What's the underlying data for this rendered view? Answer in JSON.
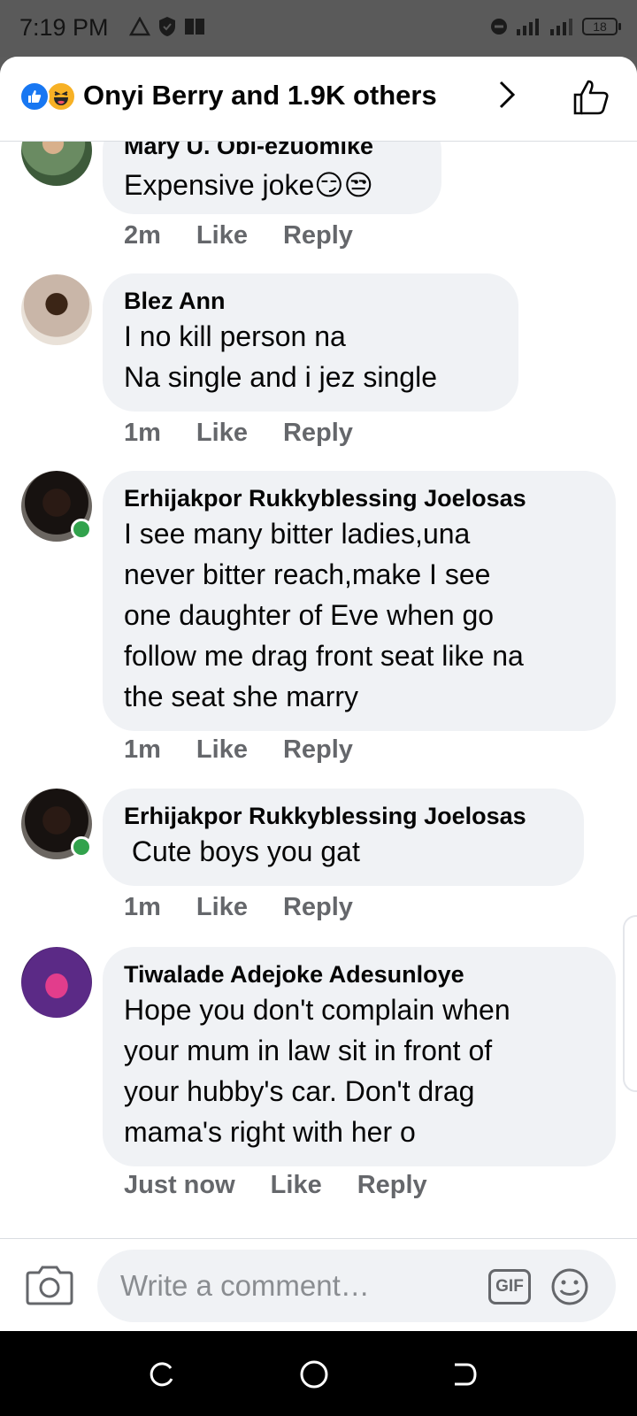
{
  "status_bar": {
    "time": "7:19 PM",
    "battery": "18"
  },
  "header": {
    "reactions_text": "Onyi Berry and 1.9K others"
  },
  "comments": [
    {
      "author": "Mary U. Obi-ezuomike",
      "text": "Expensive joke😏😒",
      "time": "2m",
      "like": "Like",
      "reply": "Reply",
      "online": false
    },
    {
      "author": "Blez Ann",
      "lines": [
        "I no kill person na",
        "Na single and i jez  single"
      ],
      "time": "1m",
      "like": "Like",
      "reply": "Reply",
      "online": false
    },
    {
      "author": "Erhijakpor Rukkyblessing Joelosas",
      "lines": [
        "I see many bitter ladies,una",
        "never bitter reach,make I see",
        "one daughter of Eve when go",
        "follow me drag front seat like na",
        "the seat she marry"
      ],
      "time": "1m",
      "like": "Like",
      "reply": "Reply",
      "online": true
    },
    {
      "author": "Erhijakpor Rukkyblessing Joelosas",
      "text": " Cute boys you gat",
      "time": "1m",
      "like": "Like",
      "reply": "Reply",
      "online": true
    },
    {
      "author": "Tiwalade Adejoke Adesunloye",
      "lines": [
        "Hope you don't complain when",
        "your mum in law sit in front of",
        "your hubby's car. Don't drag",
        "mama's right with her o"
      ],
      "time": "Just now",
      "like": "Like",
      "reply": "Reply",
      "online": false
    }
  ],
  "composer": {
    "placeholder": "Write a comment…",
    "gif_label": "GIF"
  },
  "colors": {
    "accent": "#1877f2",
    "bubble": "#f0f2f5",
    "meta_text": "#65676b",
    "online": "#31a24c"
  }
}
